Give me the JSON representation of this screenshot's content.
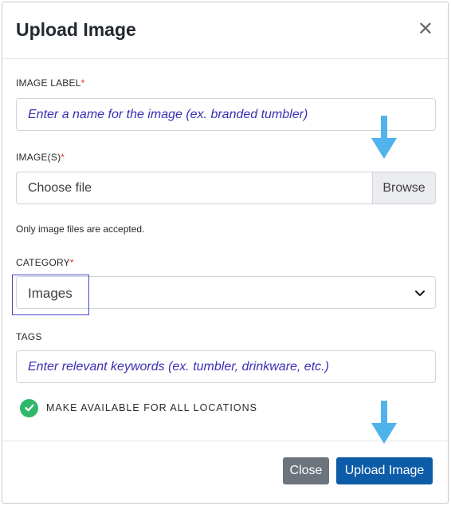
{
  "modal": {
    "title": "Upload Image",
    "close_icon": "close-icon"
  },
  "form": {
    "image_label": {
      "label": "IMAGE LABEL",
      "required_mark": "*",
      "placeholder": "Enter a name for the image (ex. branded tumbler)"
    },
    "images": {
      "label": "IMAGE(S)",
      "required_mark": "*",
      "file_text": "Choose file",
      "browse_label": "Browse",
      "help_text": "Only image files are accepted."
    },
    "category": {
      "label": "CATEGORY",
      "required_mark": "*",
      "selected": "Images"
    },
    "tags": {
      "label": "TAGS",
      "placeholder": "Enter relevant keywords (ex. tumbler, drinkware, etc.)"
    },
    "availability": {
      "label": "MAKE AVAILABLE FOR ALL LOCATIONS",
      "checked": true
    }
  },
  "footer": {
    "close_label": "Close",
    "upload_label": "Upload Image"
  },
  "colors": {
    "accent_arrow": "#4fb3ec",
    "upload_button": "#0d5ca8",
    "close_button": "#6c757d",
    "check": "#2fb86b",
    "placeholder_text": "#3b2fb4"
  }
}
